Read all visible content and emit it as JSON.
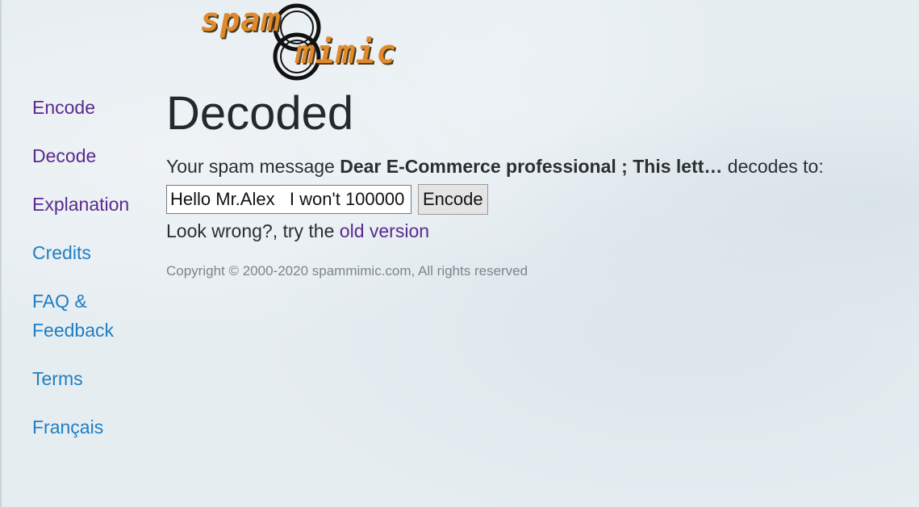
{
  "logo": {
    "word1": "spam",
    "word2": "mimic",
    "color": "#e08a2c"
  },
  "sidebar": {
    "items": [
      {
        "label": "Encode",
        "visited": true
      },
      {
        "label": "Decode",
        "visited": true
      },
      {
        "label": "Explanation",
        "visited": true
      },
      {
        "label": "Credits",
        "visited": false
      },
      {
        "label": "FAQ &",
        "label2": "Feedback",
        "visited": false
      },
      {
        "label": "Terms",
        "visited": false
      },
      {
        "label": "Français",
        "visited": false
      }
    ]
  },
  "main": {
    "title": "Decoded",
    "message_prefix": "Your spam message ",
    "spam_message": "Dear E-Commerce professional ; This lett…",
    "message_suffix": " decodes to:",
    "decoded_value": "Hello Mr.Alex   I won't 100000",
    "encode_button": "Encode",
    "wrong_prefix": "Look wrong?, try the ",
    "old_version_link": "old version",
    "copyright": "Copyright © 2000-2020 spammimic.com, All rights reserved"
  },
  "colors": {
    "link": "#1f7ec4",
    "visited_link": "#5a2a8f",
    "text": "#2b2f33"
  }
}
